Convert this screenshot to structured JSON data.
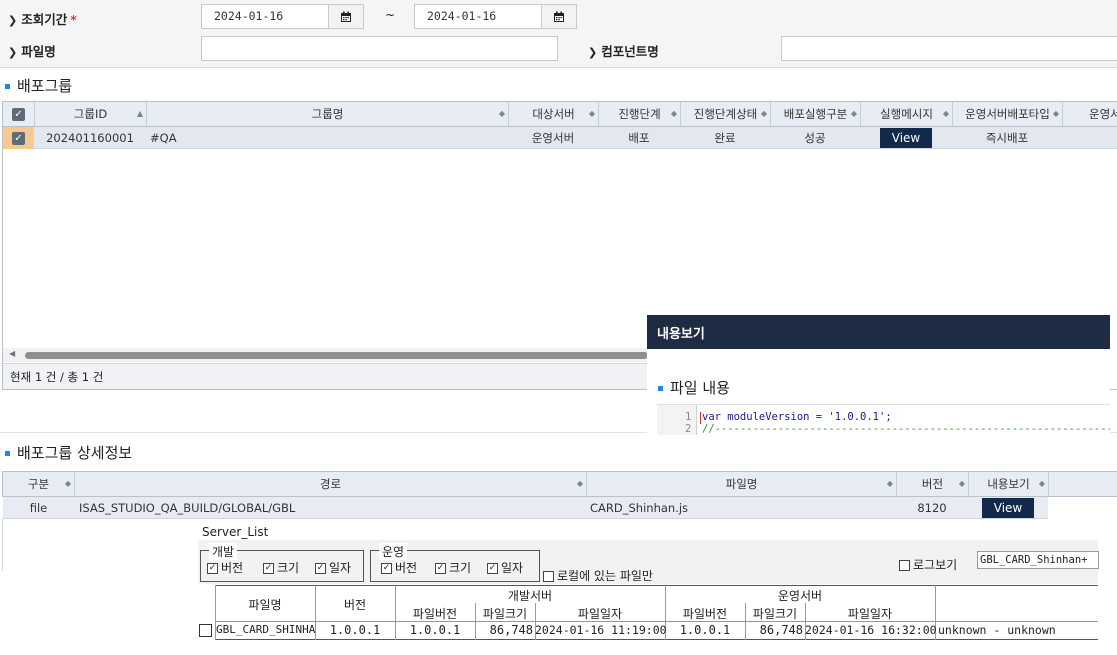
{
  "search": {
    "period_label": "조회기간",
    "required_mark": "*",
    "date_from": "2024-01-16",
    "date_to": "2024-01-16",
    "tilde": "~",
    "filename_label": "파일명",
    "filename_value": "",
    "component_label": "컴포넌트명",
    "component_value": ""
  },
  "deploy_group": {
    "title": "배포그룹",
    "columns": [
      "그룹ID",
      "그룹명",
      "대상서버",
      "진행단계",
      "진행단계상태",
      "배포실행구분",
      "실행메시지",
      "운영서버배포타입",
      "운영서"
    ],
    "row": {
      "group_id": "202401160001",
      "group_name": "#QA",
      "target_server": "운영서버",
      "stage": "배포",
      "stage_status": "완료",
      "exec_type": "성공",
      "message_button": "View",
      "deploy_type": "즉시배포"
    },
    "status_text": "현재 1 건 / 총 1 건"
  },
  "content_popup": {
    "header": "내용보기",
    "section": "파일 내용",
    "lines": [
      {
        "no": "1",
        "text": "var moduleVersion = '1.0.0.1';"
      },
      {
        "no": "2",
        "text": "//-----------------------------------------------------------------------"
      }
    ]
  },
  "detail": {
    "title": "배포그룹 상세정보",
    "columns": [
      "구분",
      "경로",
      "파일명",
      "버전",
      "내용보기"
    ],
    "row": {
      "type": "file",
      "path": "ISAS_STUDIO_QA_BUILD/GLOBAL/GBL",
      "file_name": "CARD_Shinhan.js",
      "version": "8120",
      "view_button": "View"
    }
  },
  "server_list": {
    "title": "Server_List",
    "dev_group": "개발",
    "ops_group": "운영",
    "opt_version": "버전",
    "opt_size": "크기",
    "opt_date": "일자",
    "local_files": "로컬에 있는 파일만",
    "log_view": "로그보기",
    "select_value": "GBL_CARD_Shinhan+",
    "headers": {
      "file_name": "파일명",
      "version": "버전",
      "dev_server": "개발서버",
      "ops_server": "운영서버",
      "file_version": "파일버전",
      "file_size": "파일크기",
      "file_date": "파일일자"
    },
    "row": {
      "file_name": "GBL_CARD_SHINHAN",
      "version": "1.0.0.1",
      "dev_version": "1.0.0.1",
      "dev_size": "86,748",
      "dev_date": "2024-01-16 11:19:00",
      "ops_version": "1.0.0.1",
      "ops_size": "86,748",
      "ops_date": "2024-01-16 16:32:00",
      "note": "unknown - unknown"
    }
  }
}
